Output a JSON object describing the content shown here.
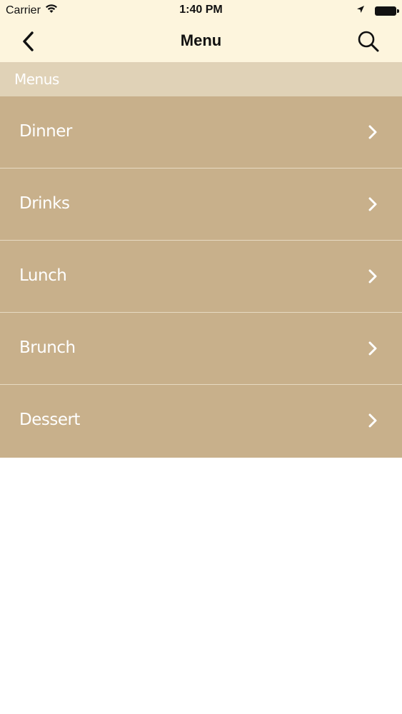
{
  "status_bar": {
    "carrier": "Carrier",
    "time": "1:40 PM",
    "icons": [
      "wifi-icon",
      "location-arrow-icon",
      "battery-icon"
    ]
  },
  "nav_bar": {
    "title": "Menu",
    "back_icon": "chevron-left-icon",
    "search_icon": "search-icon"
  },
  "section": {
    "header": "Menus"
  },
  "menu_items": [
    {
      "label": "Dinner"
    },
    {
      "label": "Drinks"
    },
    {
      "label": "Lunch"
    },
    {
      "label": "Brunch"
    },
    {
      "label": "Dessert"
    }
  ],
  "colors": {
    "nav_background": "#fdf5dd",
    "section_header_background": "#e0d2b7",
    "row_background": "#c8b08b",
    "row_separator": "#e7dac2",
    "row_text": "#ffffff"
  }
}
